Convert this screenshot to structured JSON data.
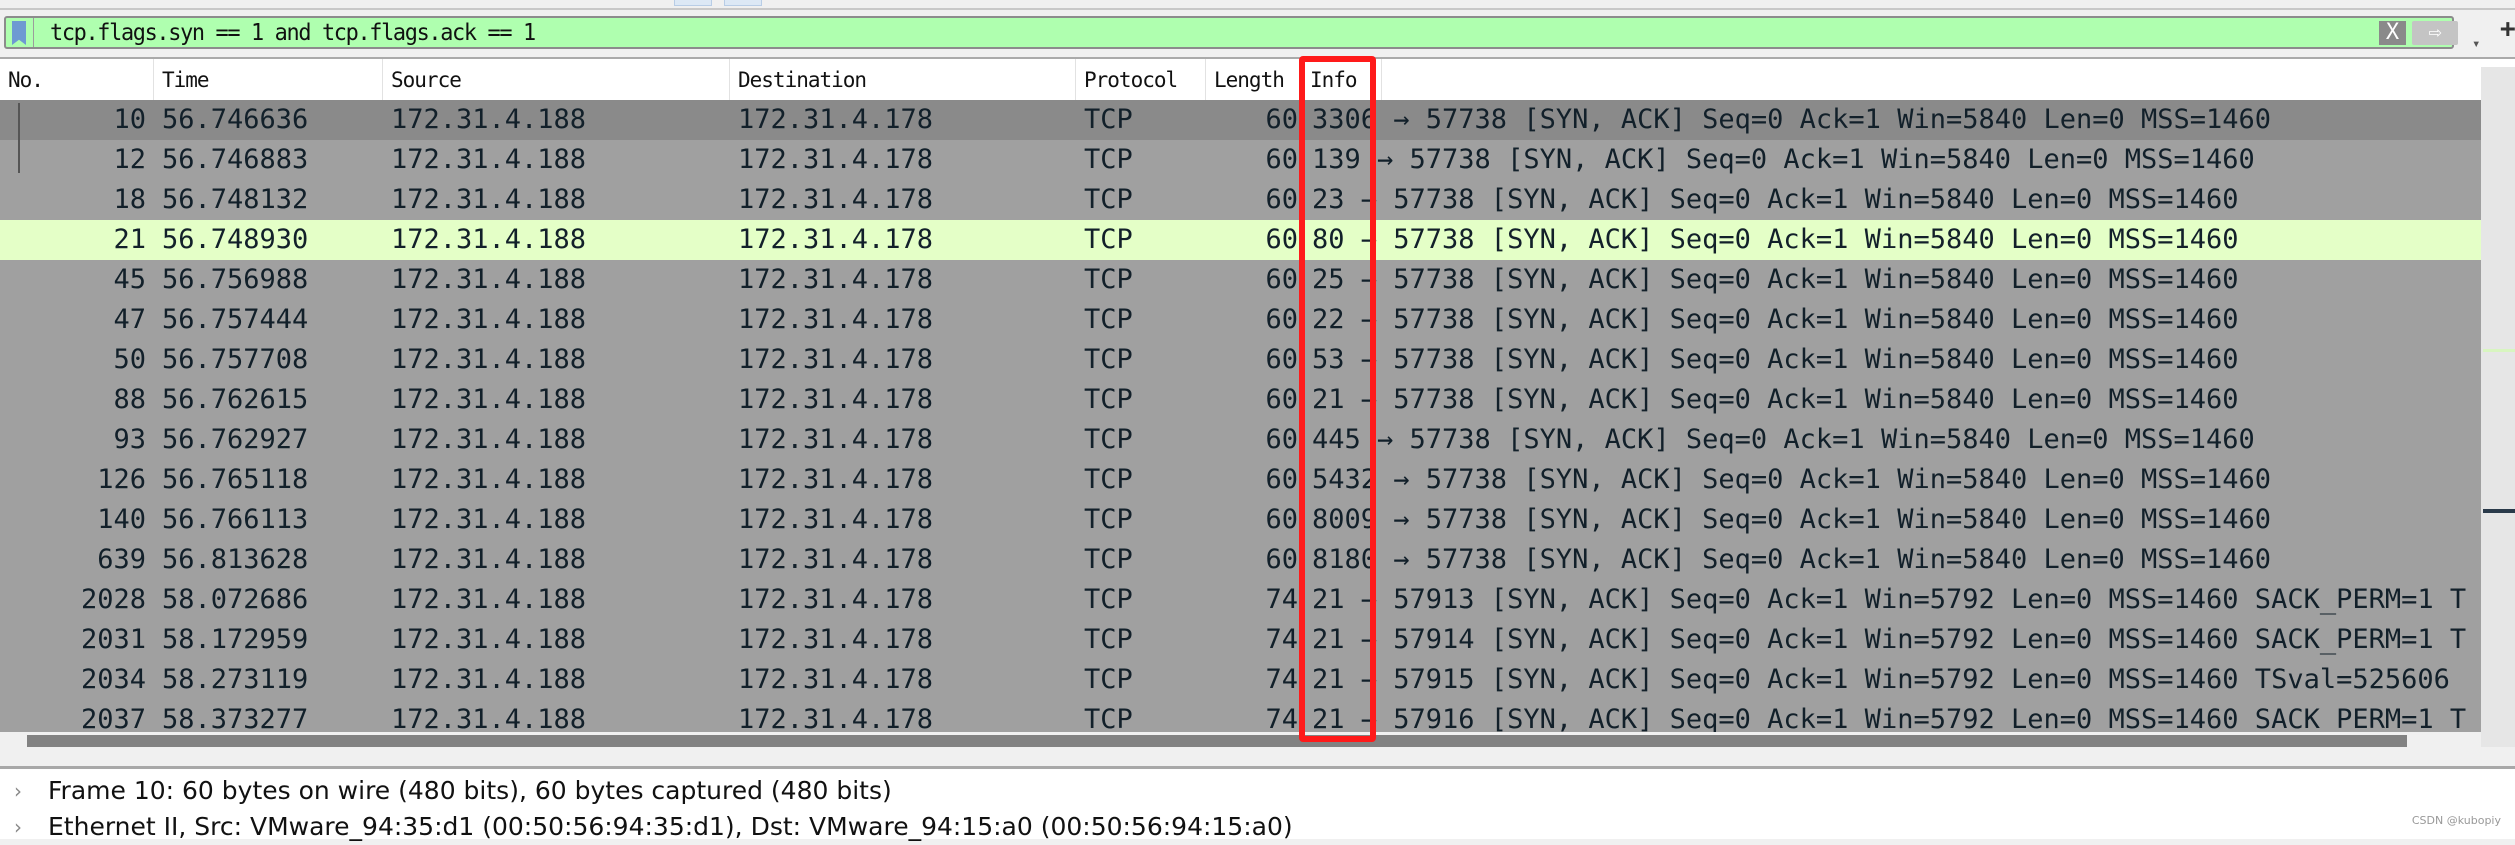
{
  "filter": {
    "value": "tcp.flags.syn == 1 and tcp.flags.ack == 1",
    "clear_label": "X",
    "apply_label": "⇨",
    "dropdown_label": "▾",
    "add_label": "+",
    "background_color": "#afffaf"
  },
  "columns": [
    "No.",
    "Time",
    "Source",
    "Destination",
    "Protocol",
    "Length",
    "Info"
  ],
  "rows": [
    {
      "no": "10",
      "time": "56.746636",
      "src": "172.31.4.188",
      "dst": "172.31.4.178",
      "proto": "TCP",
      "len": "60",
      "info": "3306 → 57738 [SYN, ACK] Seq=0 Ack=1 Win=5840 Len=0 MSS=1460",
      "state": "selected"
    },
    {
      "no": "12",
      "time": "56.746883",
      "src": "172.31.4.188",
      "dst": "172.31.4.178",
      "proto": "TCP",
      "len": "60",
      "info": "139 → 57738 [SYN, ACK] Seq=0 Ack=1 Win=5840 Len=0 MSS=1460",
      "state": ""
    },
    {
      "no": "18",
      "time": "56.748132",
      "src": "172.31.4.188",
      "dst": "172.31.4.178",
      "proto": "TCP",
      "len": "60",
      "info": "23 → 57738 [SYN, ACK] Seq=0 Ack=1 Win=5840 Len=0 MSS=1460",
      "state": ""
    },
    {
      "no": "21",
      "time": "56.748930",
      "src": "172.31.4.188",
      "dst": "172.31.4.178",
      "proto": "TCP",
      "len": "60",
      "info": "80 → 57738 [SYN, ACK] Seq=0 Ack=1 Win=5840 Len=0 MSS=1460",
      "state": "highlight"
    },
    {
      "no": "45",
      "time": "56.756988",
      "src": "172.31.4.188",
      "dst": "172.31.4.178",
      "proto": "TCP",
      "len": "60",
      "info": "25 → 57738 [SYN, ACK] Seq=0 Ack=1 Win=5840 Len=0 MSS=1460",
      "state": ""
    },
    {
      "no": "47",
      "time": "56.757444",
      "src": "172.31.4.188",
      "dst": "172.31.4.178",
      "proto": "TCP",
      "len": "60",
      "info": "22 → 57738 [SYN, ACK] Seq=0 Ack=1 Win=5840 Len=0 MSS=1460",
      "state": ""
    },
    {
      "no": "50",
      "time": "56.757708",
      "src": "172.31.4.188",
      "dst": "172.31.4.178",
      "proto": "TCP",
      "len": "60",
      "info": "53 → 57738 [SYN, ACK] Seq=0 Ack=1 Win=5840 Len=0 MSS=1460",
      "state": ""
    },
    {
      "no": "88",
      "time": "56.762615",
      "src": "172.31.4.188",
      "dst": "172.31.4.178",
      "proto": "TCP",
      "len": "60",
      "info": "21 → 57738 [SYN, ACK] Seq=0 Ack=1 Win=5840 Len=0 MSS=1460",
      "state": ""
    },
    {
      "no": "93",
      "time": "56.762927",
      "src": "172.31.4.188",
      "dst": "172.31.4.178",
      "proto": "TCP",
      "len": "60",
      "info": "445 → 57738 [SYN, ACK] Seq=0 Ack=1 Win=5840 Len=0 MSS=1460",
      "state": ""
    },
    {
      "no": "126",
      "time": "56.765118",
      "src": "172.31.4.188",
      "dst": "172.31.4.178",
      "proto": "TCP",
      "len": "60",
      "info": "5432 → 57738 [SYN, ACK] Seq=0 Ack=1 Win=5840 Len=0 MSS=1460",
      "state": ""
    },
    {
      "no": "140",
      "time": "56.766113",
      "src": "172.31.4.188",
      "dst": "172.31.4.178",
      "proto": "TCP",
      "len": "60",
      "info": "8009 → 57738 [SYN, ACK] Seq=0 Ack=1 Win=5840 Len=0 MSS=1460",
      "state": ""
    },
    {
      "no": "639",
      "time": "56.813628",
      "src": "172.31.4.188",
      "dst": "172.31.4.178",
      "proto": "TCP",
      "len": "60",
      "info": "8180 → 57738 [SYN, ACK] Seq=0 Ack=1 Win=5840 Len=0 MSS=1460",
      "state": ""
    },
    {
      "no": "2028",
      "time": "58.072686",
      "src": "172.31.4.188",
      "dst": "172.31.4.178",
      "proto": "TCP",
      "len": "74",
      "info": "21 → 57913 [SYN, ACK] Seq=0 Ack=1 Win=5792 Len=0 MSS=1460 SACK_PERM=1 T",
      "state": ""
    },
    {
      "no": "2031",
      "time": "58.172959",
      "src": "172.31.4.188",
      "dst": "172.31.4.178",
      "proto": "TCP",
      "len": "74",
      "info": "21 → 57914 [SYN, ACK] Seq=0 Ack=1 Win=5792 Len=0 MSS=1460 SACK_PERM=1 T",
      "state": ""
    },
    {
      "no": "2034",
      "time": "58.273119",
      "src": "172.31.4.188",
      "dst": "172.31.4.178",
      "proto": "TCP",
      "len": "74",
      "info": "21 → 57915 [SYN, ACK] Seq=0 Ack=1 Win=5792 Len=0 MSS=1460 TSval=525606",
      "state": ""
    },
    {
      "no": "2037",
      "time": "58.373277",
      "src": "172.31.4.188",
      "dst": "172.31.4.178",
      "proto": "TCP",
      "len": "74",
      "info": "21 → 57916 [SYN, ACK] Seq=0 Ack=1 Win=5792 Len=0 MSS=1460 SACK_PERM=1 T",
      "state": ""
    }
  ],
  "details": [
    {
      "expander": "›",
      "text": "Frame 10: 60 bytes on wire (480 bits), 60 bytes captured (480 bits)"
    },
    {
      "expander": "›",
      "text": "Ethernet II, Src: VMware_94:35:d1 (00:50:56:94:35:d1), Dst: VMware_94:15:a0 (00:50:56:94:15:a0)"
    }
  ],
  "watermark": "CSDN @kubopiy",
  "colors": {
    "selected_row": "#8a8a8a",
    "row": "#a0a0a0",
    "highlight_row": "#e4ffc7",
    "annotation_box": "#ff1a1a"
  }
}
